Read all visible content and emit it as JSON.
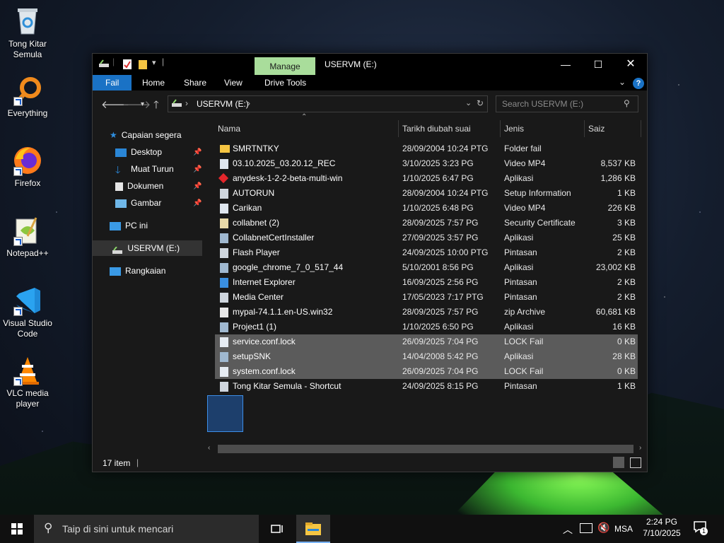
{
  "desktop": {
    "icons": [
      {
        "label": "Tong Kitar Semula",
        "icon": "recycle-bin-icon"
      },
      {
        "label": "Everything",
        "icon": "everything-search-icon"
      },
      {
        "label": "Firefox",
        "icon": "firefox-icon"
      },
      {
        "label": "Notepad++",
        "icon": "notepad-plus-plus-icon"
      },
      {
        "label": "Visual Studio Code",
        "icon": "vscode-icon"
      },
      {
        "label": "VLC media player",
        "icon": "vlc-icon"
      }
    ]
  },
  "window": {
    "title": "USERVM (E:)",
    "manage_tab": "Manage",
    "ribbon_tabs": [
      "Fail",
      "Home",
      "Share",
      "View",
      "Drive Tools"
    ],
    "address": "USERVM (E:)",
    "search_placeholder": "Search USERVM (E:)",
    "status": "17 item"
  },
  "nav": {
    "quick_access": "Capaian segera",
    "items": [
      {
        "label": "Desktop",
        "pinned": true
      },
      {
        "label": "Muat Turun",
        "pinned": true
      },
      {
        "label": "Dokumen",
        "pinned": true
      },
      {
        "label": "Gambar",
        "pinned": true
      }
    ],
    "this_pc": "PC ini",
    "drive": "USERVM (E:)",
    "network": "Rangkaian"
  },
  "columns": [
    "Nama",
    "Tarikh diubah suai",
    "Jenis",
    "Saiz"
  ],
  "files": [
    {
      "name": "SMRTNTKY",
      "date": "28/09/2004 10:24 PTG",
      "type": "Folder fail",
      "size": "",
      "icon": "folder-icon",
      "selected": false
    },
    {
      "name": "03.10.2025_03.20.12_REC",
      "date": "3/10/2025 3:23 PG",
      "type": "Video MP4",
      "size": "8,537 KB",
      "icon": "video-file-icon",
      "selected": false
    },
    {
      "name": "anydesk-1-2-2-beta-multi-win",
      "date": "1/10/2025 6:47 PG",
      "type": "Aplikasi",
      "size": "1,286 KB",
      "icon": "anydesk-icon",
      "selected": false
    },
    {
      "name": "AUTORUN",
      "date": "28/09/2004 10:24 PTG",
      "type": "Setup Information",
      "size": "1 KB",
      "icon": "setup-info-icon",
      "selected": false
    },
    {
      "name": "Carikan",
      "date": "1/10/2025 6:48 PG",
      "type": "Video MP4",
      "size": "226 KB",
      "icon": "video-file-icon",
      "selected": false
    },
    {
      "name": "collabnet (2)",
      "date": "28/09/2025 7:57 PG",
      "type": "Security Certificate",
      "size": "3 KB",
      "icon": "certificate-icon",
      "selected": false
    },
    {
      "name": "CollabnetCertInstaller",
      "date": "27/09/2025 3:57 PG",
      "type": "Aplikasi",
      "size": "25 KB",
      "icon": "application-icon",
      "selected": false
    },
    {
      "name": "Flash Player",
      "date": "24/09/2025 10:00 PTG",
      "type": "Pintasan",
      "size": "2 KB",
      "icon": "shortcut-file-icon",
      "selected": false
    },
    {
      "name": "google_chrome_7_0_517_44",
      "date": "5/10/2001 8:56 PG",
      "type": "Aplikasi",
      "size": "23,002 KB",
      "icon": "application-icon",
      "selected": false
    },
    {
      "name": "Internet Explorer",
      "date": "16/09/2025 2:56 PG",
      "type": "Pintasan",
      "size": "2 KB",
      "icon": "internet-explorer-icon",
      "selected": false
    },
    {
      "name": "Media Center",
      "date": "17/05/2023 7:17 PTG",
      "type": "Pintasan",
      "size": "2 KB",
      "icon": "shortcut-file-icon",
      "selected": false
    },
    {
      "name": "mypal-74.1.1.en-US.win32",
      "date": "28/09/2025 7:57 PG",
      "type": "zip Archive",
      "size": "60,681 KB",
      "icon": "zip-archive-icon",
      "selected": false
    },
    {
      "name": "Project1 (1)",
      "date": "1/10/2025 6:50 PG",
      "type": "Aplikasi",
      "size": "16 KB",
      "icon": "application-icon",
      "selected": false
    },
    {
      "name": "service.conf.lock",
      "date": "26/09/2025 7:04 PG",
      "type": "LOCK Fail",
      "size": "0 KB",
      "icon": "blank-file-icon",
      "selected": true
    },
    {
      "name": "setupSNK",
      "date": "14/04/2008 5:42 PG",
      "type": "Aplikasi",
      "size": "28 KB",
      "icon": "application-icon",
      "selected": true
    },
    {
      "name": "system.conf.lock",
      "date": "26/09/2025 7:04 PG",
      "type": "LOCK Fail",
      "size": "0 KB",
      "icon": "blank-file-icon",
      "selected": true
    },
    {
      "name": "Tong Kitar Semula - Shortcut",
      "date": "24/09/2025 8:15 PG",
      "type": "Pintasan",
      "size": "1 KB",
      "icon": "shortcut-file-icon",
      "selected": false
    }
  ],
  "taskbar": {
    "search_placeholder": "Taip di sini untuk mencari",
    "language": "MSA",
    "time": "2:24 PG",
    "date": "7/10/2025",
    "notification_count": "1"
  },
  "colors": {
    "accent": "#1a72c5",
    "manage_tab": "#a9dd9b",
    "selection": "#5b5b5b"
  }
}
